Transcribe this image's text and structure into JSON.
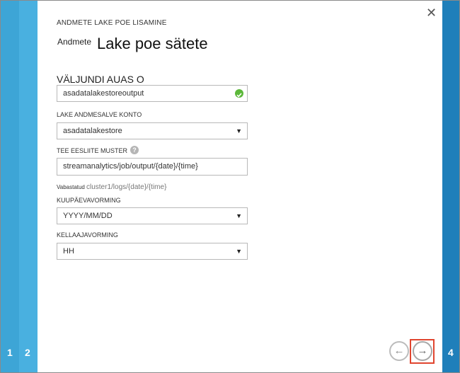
{
  "wizard": {
    "breadcrumb": "ANDMETE LAKE POE LISAMINE",
    "title_prefix": "Andmete",
    "title": "Lake poe sätete",
    "close_icon": "close-icon",
    "steps": [
      "1",
      "2",
      "4"
    ]
  },
  "form": {
    "output_alias": {
      "label": "VÄLJUNDI AUAS O",
      "value": "asadatalakestoreoutput",
      "status_icon": "check-icon"
    },
    "account": {
      "label": "LAKE ANDMESALVE KONTO",
      "selected": "asadatalakestore"
    },
    "prefix_pattern": {
      "label": "TEE EESLIITE MUSTER",
      "help_icon": "help-icon",
      "help_glyph": "?",
      "value": "streamanalytics/job/output/{date}/{time}"
    },
    "sample": {
      "label": "Vabastatud",
      "value": "cluster1/logs/{date}/{time}"
    },
    "date_format": {
      "label": "KUUPÄEVAVORMING",
      "selected": "YYYY/MM/DD"
    },
    "time_format": {
      "label": "KELLAAJAVORMING",
      "selected": "HH"
    }
  },
  "nav": {
    "back_icon": "arrow-left-icon",
    "back_glyph": "←",
    "next_icon": "arrow-right-icon",
    "next_glyph": "→"
  },
  "colors": {
    "step1": "#3da5d6",
    "step2": "#49b0e0",
    "step4": "#1f7fba",
    "success": "#5cb83a",
    "highlight": "#e0452f"
  }
}
